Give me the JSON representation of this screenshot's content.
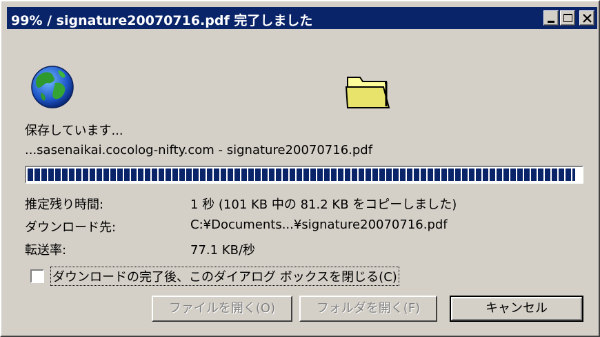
{
  "window": {
    "title": "99% / signature20070716.pdf 完了しました",
    "title_bar_color": "#0a246a",
    "face_color": "#d4d0c8"
  },
  "status": {
    "saving_label": "保存しています...",
    "source_line": "...sasenaikai.cocolog-nifty.com - signature20070716.pdf"
  },
  "progress": {
    "percent": 99,
    "segment_color": "#0a246a"
  },
  "details": {
    "eta_label": "推定残り時間:",
    "eta_value": "1 秒 (101 KB 中の 81.2 KB をコピーしました)",
    "dest_label": "ダウンロード先:",
    "dest_value": "C:¥Documents...¥signature20070716.pdf",
    "rate_label": "転送率:",
    "rate_value": "77.1 KB/秒"
  },
  "options": {
    "close_on_complete_label": "ダウンロードの完了後、このダイアログ ボックスを閉じる(C)",
    "close_on_complete_checked": false
  },
  "buttons": {
    "open_file": "ファイルを開く(O)",
    "open_folder": "フォルダを開く(F)",
    "cancel": "キャンセル"
  },
  "icons": {
    "left": "globe-icon",
    "right": "folder-icon",
    "minimize": "minimize-icon",
    "maximize": "maximize-icon",
    "close": "close-icon"
  }
}
